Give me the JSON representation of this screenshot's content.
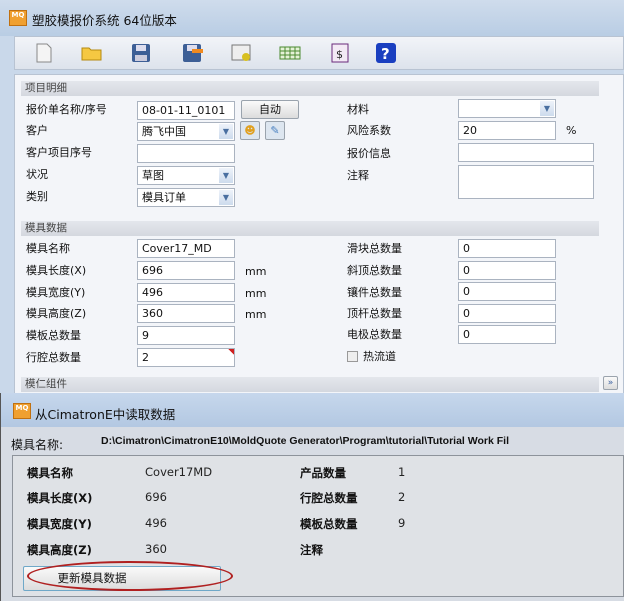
{
  "app": {
    "title": "塑胶模报价系统 64位版本",
    "icon_text": "MQ"
  },
  "toolbar": [
    "new-file-icon",
    "open-folder-icon",
    "save-icon",
    "save-as-icon",
    "settings-report-icon",
    "table-icon",
    "price-sheet-icon",
    "help-icon"
  ],
  "project": {
    "header": "项目明细",
    "quote_name_label": "报价单名称/序号",
    "quote_name_value": "08-01-11_0101",
    "auto_button": "自动",
    "customer_label": "客户",
    "customer_value": "腾飞中国",
    "customer_project_label": "客户项目序号",
    "customer_project_value": "",
    "status_label": "状况",
    "status_value": "草图",
    "category_label": "类别",
    "category_value": "模具订单",
    "material_label": "材料",
    "material_value": "",
    "risk_label": "风险系数",
    "risk_value": "20",
    "risk_unit": "%",
    "quote_info_label": "报价信息",
    "quote_info_value": "",
    "notes_label": "注释",
    "notes_value": ""
  },
  "mold": {
    "header": "模具数据",
    "left": [
      {
        "label": "模具名称",
        "value": "Cover17_MD",
        "unit": ""
      },
      {
        "label": "模具长度(X)",
        "value": "696",
        "unit": "mm"
      },
      {
        "label": "模具宽度(Y)",
        "value": "496",
        "unit": "mm"
      },
      {
        "label": "模具高度(Z)",
        "value": "360",
        "unit": "mm"
      },
      {
        "label": "模板总数量",
        "value": "9",
        "unit": ""
      },
      {
        "label": "行腔总数量",
        "value": "2",
        "unit": ""
      }
    ],
    "right": [
      {
        "label": "滑块总数量",
        "value": "0"
      },
      {
        "label": "斜顶总数量",
        "value": "0"
      },
      {
        "label": "镶件总数量",
        "value": "0"
      },
      {
        "label": "顶杆总数量",
        "value": "0"
      },
      {
        "label": "电极总数量",
        "value": "0"
      }
    ],
    "hot_runner_label": "热流道"
  },
  "core": {
    "header": "模仁组件",
    "expand": "»"
  },
  "dialog": {
    "title": "从CimatronE中读取数据",
    "path_label": "模具名称:",
    "path_value": "D:\\Cimatron\\CimatronE10\\MoldQuote Generator\\Program\\tutorial\\Tutorial Work Fil",
    "left": [
      {
        "label": "模具名称",
        "value": "Cover17MD"
      },
      {
        "label": "模具长度(X)",
        "value": "696"
      },
      {
        "label": "模具宽度(Y)",
        "value": "496"
      },
      {
        "label": "模具高度(Z)",
        "value": "360"
      }
    ],
    "right": [
      {
        "label": "产品数量",
        "value": "1"
      },
      {
        "label": "行腔总数量",
        "value": "2"
      },
      {
        "label": "模板总数量",
        "value": "9"
      },
      {
        "label": "注释",
        "value": ""
      }
    ],
    "update_button": "更新模具数据"
  }
}
